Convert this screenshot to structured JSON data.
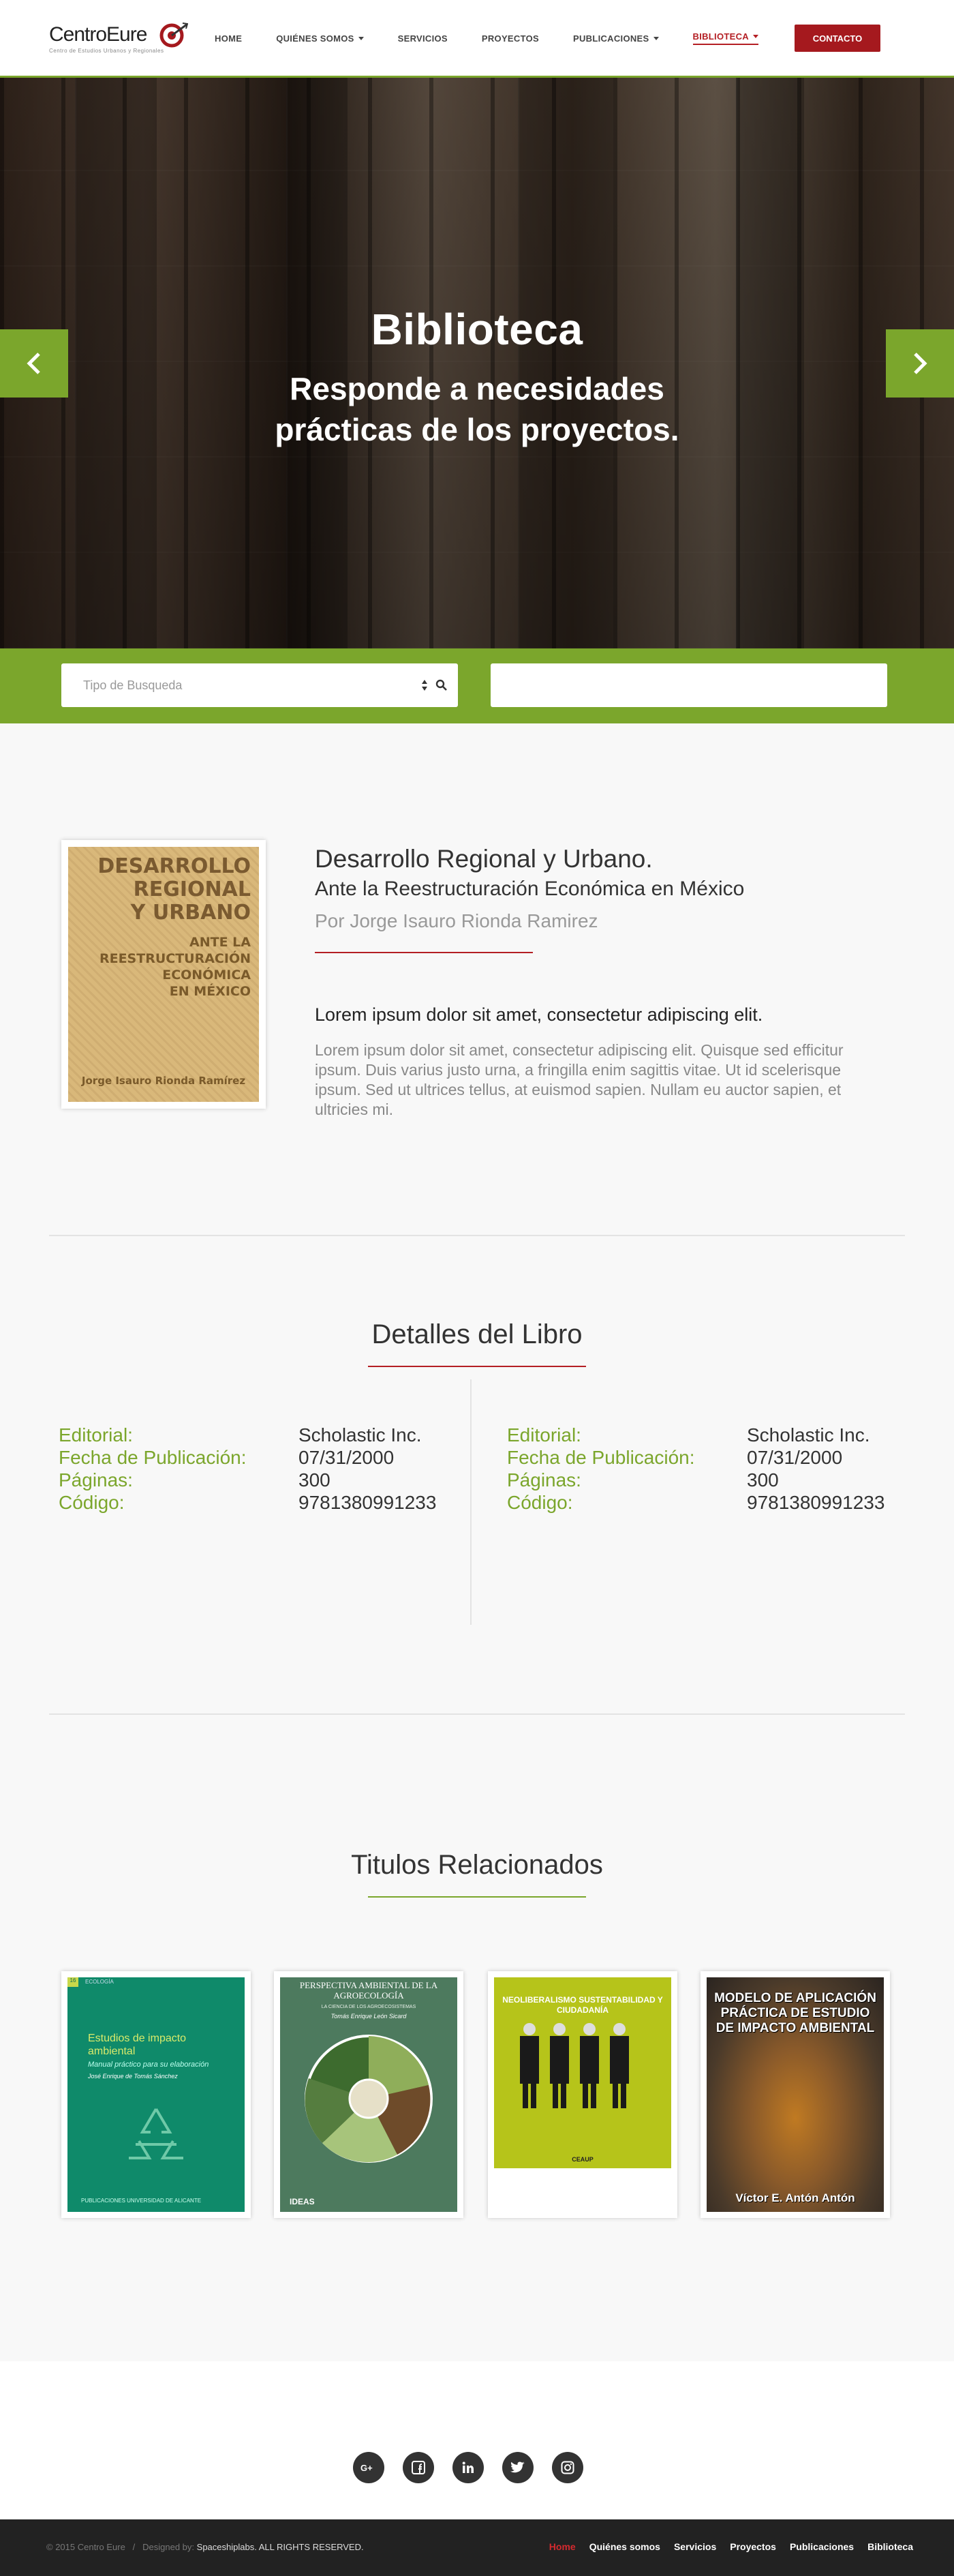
{
  "nav": {
    "logo": "CentroEure",
    "logo_tagline": "Centro de Estudios Urbanos y Regionales",
    "items": [
      {
        "label": "HOME",
        "caret": false
      },
      {
        "label": "QUIÉNES SOMOS",
        "caret": true
      },
      {
        "label": "SERVICIOS",
        "caret": false
      },
      {
        "label": "PROYECTOS",
        "caret": false
      },
      {
        "label": "PUBLICACIONES",
        "caret": true
      },
      {
        "label": "BIBLIOTECA",
        "caret": true
      }
    ],
    "active_index": 5,
    "contact": "CONTACTO"
  },
  "hero": {
    "title": "Biblioteca",
    "subtitle_line1": "Responde a necesidades",
    "subtitle_line2": "prácticas de los proyectos."
  },
  "search": {
    "select_placeholder": "Tipo de Busqueda",
    "input_value": ""
  },
  "book": {
    "title": "Desarrollo Regional y Urbano.",
    "subtitle": "Ante la Reestructuración Económica en México",
    "author": "Por Jorge Isauro Rionda Ramirez",
    "lead": "Lorem ipsum dolor sit amet, consectetur adipiscing elit.",
    "body": "Lorem ipsum dolor sit amet, consectetur adipiscing elit. Quisque sed efficitur ipsum. Duis varius justo urna, a fringilla enim sagittis vitae. Ut id scelerisque ipsum. Sed ut ultrices tellus, at euismod sapien. Nullam eu auctor sapien, et ultricies mi.",
    "cover": {
      "line1": "DESARROLLO",
      "line2": "REGIONAL",
      "line3": "Y URBANO",
      "line4": "ANTE LA",
      "line5": "REESTRUCTURACIÓN",
      "line6": "ECONÓMICA",
      "line7": "EN MÉXICO",
      "author": "Jorge Isauro Rionda Ramírez"
    }
  },
  "details": {
    "title": "Detalles del Libro",
    "labels": [
      "Editorial:",
      "Fecha de Publicación:",
      "Páginas:",
      "Código:"
    ],
    "left": [
      "Scholastic Inc.",
      "07/31/2000",
      "300",
      "9781380991233"
    ],
    "right": [
      "Scholastic Inc.",
      "07/31/2000",
      "300",
      "9781380991233"
    ]
  },
  "related": {
    "title": "Titulos Relacionados",
    "books": [
      {
        "title": "Estudios de impacto ambiental",
        "sub": "Manual práctico para su elaboración",
        "author": "José Enrique de Tomás Sánchez",
        "publisher": "PUBLICACIONES UNIVERSIDAD DE ALICANTE",
        "tag": "ECOLOGÍA",
        "num": "16"
      },
      {
        "title": "PERSPECTIVA AMBIENTAL DE LA AGROECOLOGÍA",
        "sub": "LA CIENCIA DE LOS AGROECOSISTEMAS",
        "author": "Tomás Enrique León Sicard",
        "publisher": "IDEAS"
      },
      {
        "title": "NEOLIBERALISMO SUSTENTABILIDAD Y CIUDADANÍA",
        "publisher": "CEAUP"
      },
      {
        "title": "MODELO DE APLICACIÓN PRÁCTICA DE ESTUDIO DE IMPACTO AMBIENTAL",
        "author": "Víctor E. Antón Antón"
      }
    ]
  },
  "footer": {
    "copyright": "© 2015 Centro Eure",
    "designed_by": "Designed by:",
    "designer": "Spaceshiplabs",
    "rights": ". ALL RIGHTS RESERVED.",
    "links": [
      "Home",
      "Quiénes somos",
      "Servicios",
      "Proyectos",
      "Publicaciones",
      "Biblioteca"
    ],
    "social": [
      "google-plus",
      "facebook",
      "linkedin",
      "twitter",
      "instagram"
    ]
  },
  "colors": {
    "green": "#7ba62c",
    "red": "#a5191e",
    "dark": "#222222"
  }
}
